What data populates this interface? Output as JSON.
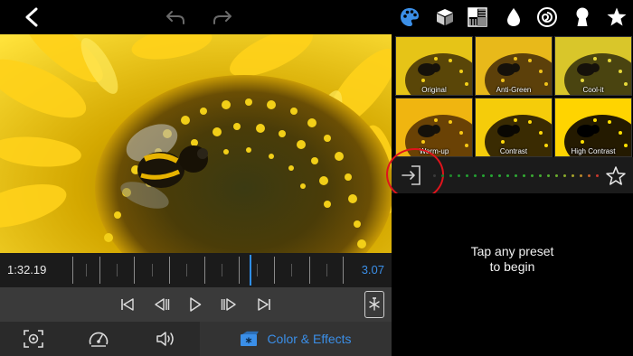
{
  "timeline": {
    "current_time": "1:32.19",
    "duration": "3.07"
  },
  "tabs": {
    "active_label": "Color & Effects"
  },
  "presets": [
    {
      "label": "Original"
    },
    {
      "label": "Anti-Green"
    },
    {
      "label": "Cool-it"
    },
    {
      "label": "Warm-up"
    },
    {
      "label": "Contrast"
    },
    {
      "label": "High Contrast"
    }
  ],
  "empty_state": {
    "line1": "Tap any preset",
    "line2": "to begin"
  },
  "icons": {
    "back": "chevron-left-icon",
    "undo": "undo-icon",
    "redo": "redo-icon",
    "tools": [
      "palette-icon",
      "cube-icon",
      "pattern-icon",
      "drop-icon",
      "swirl-icon",
      "keyhole-icon",
      "star-icon"
    ],
    "transport": [
      "skip-start-icon",
      "frame-back-icon",
      "play-icon",
      "frame-forward-icon",
      "skip-end-icon",
      "freeze-frame-icon"
    ],
    "tabs": [
      "crop-focus-icon",
      "speed-icon",
      "volume-icon",
      "color-effects-icon"
    ],
    "apply": "apply-to-clip-icon",
    "favorite": "star-outline-icon"
  },
  "colors": {
    "accent": "#3b8fe8",
    "highlight": "#e0141c"
  }
}
